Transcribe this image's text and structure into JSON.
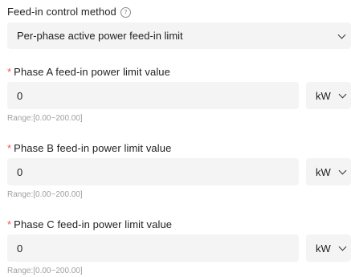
{
  "feed_in_method": {
    "label": "Feed-in control method",
    "help_icon": "question-circle-icon",
    "selected": "Per-phase active power feed-in limit"
  },
  "required_marker": "*",
  "phases": [
    {
      "label": "Phase A feed-in power limit value",
      "value": "0",
      "unit": "kW",
      "range": "Range:[0.00~200.00]"
    },
    {
      "label": "Phase B feed-in power limit value",
      "value": "0",
      "unit": "kW",
      "range": "Range:[0.00~200.00]"
    },
    {
      "label": "Phase C feed-in power limit value",
      "value": "0",
      "unit": "kW",
      "range": "Range:[0.00~200.00]"
    }
  ]
}
